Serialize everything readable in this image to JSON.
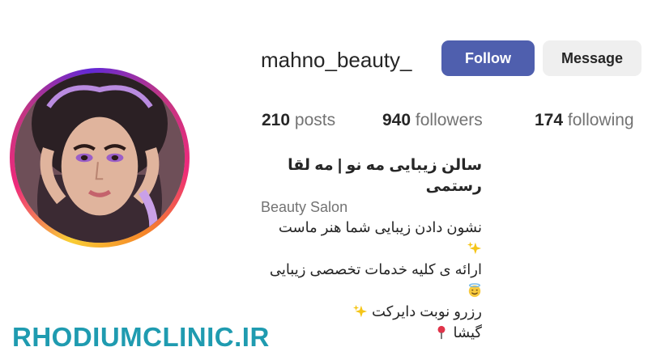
{
  "profile": {
    "username": "mahno_beauty_",
    "follow_label": "Follow",
    "message_label": "Message"
  },
  "stats": {
    "posts_count": "210",
    "posts_label": "posts",
    "followers_count": "940",
    "followers_label": "followers",
    "following_count": "174",
    "following_label": "following"
  },
  "bio": {
    "name": "سالن زیبایی مه نو | مه لقا رستمی",
    "category": "Beauty Salon",
    "lines": [
      "نشون دادن زیبایی شما هنر ماست",
      "ارائه ی کلیه خدمات تخصصی زیبایی",
      "رزرو نوبت دایرکت",
      "گیشا"
    ],
    "line_icons": [
      "sparkles-icon",
      "smiling-face-with-halo-icon",
      "sparkles-icon",
      "round-pushpin-icon"
    ]
  },
  "watermark": "RHODIUMCLINIC.IR",
  "colors": {
    "follow_button": "#4f5fae",
    "message_button": "#efefef",
    "watermark": "#1f9bb0",
    "muted_text": "#737373"
  }
}
